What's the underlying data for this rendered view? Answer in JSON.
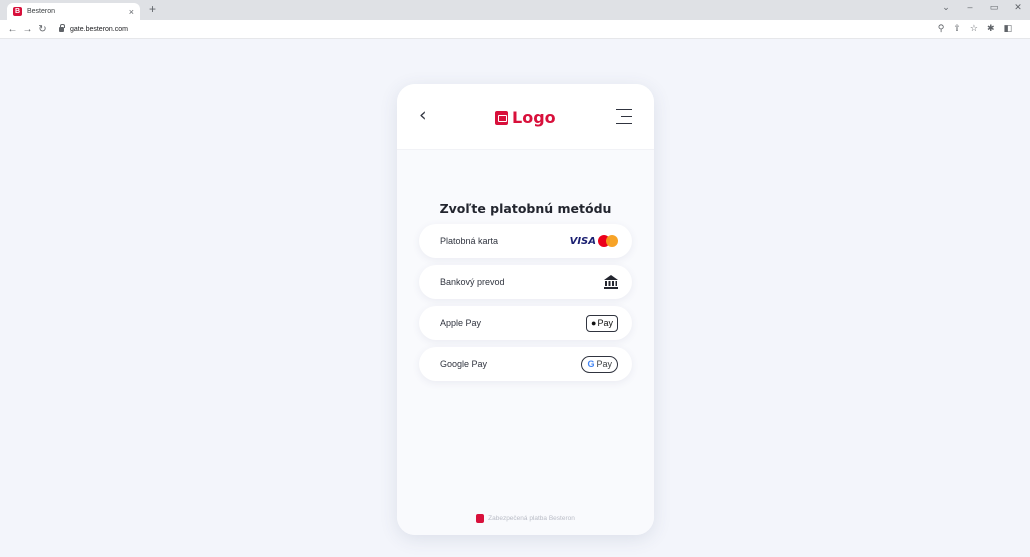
{
  "browser": {
    "tab_title": "Besteron",
    "tab_close": "×",
    "new_tab": "+",
    "url": "gate.besteron.com",
    "window_controls": [
      "⌄",
      "–",
      "▭",
      "✕"
    ],
    "toolbar_icons": [
      "zoom-icon",
      "share-icon",
      "star-icon",
      "extensions-icon",
      "sidebar-icon"
    ]
  },
  "header": {
    "back_icon": "‹",
    "logo_text": "Logo"
  },
  "page": {
    "title": "Zvoľte platobnú metódu"
  },
  "payment_methods": [
    {
      "label": "Platobná karta",
      "badge": "VISA"
    },
    {
      "label": "Bankový prevod"
    },
    {
      "label": "Apple Pay",
      "badge": "Pay",
      "badge_prefix": ""
    },
    {
      "label": "Google Pay",
      "badge": "Pay",
      "badge_prefix": "G"
    }
  ],
  "footer": {
    "text": "Zabezpečená platba Besteron"
  },
  "colors": {
    "brand": "#d8103b",
    "background": "#f3f5fb",
    "text": "#23262f"
  }
}
